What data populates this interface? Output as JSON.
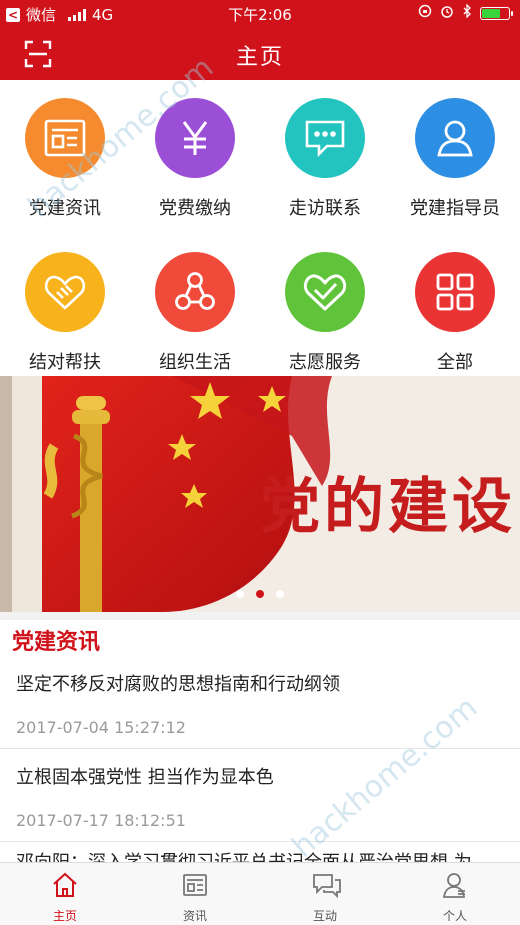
{
  "status": {
    "back_app": "微信",
    "carrier": "4G",
    "time": "下午2:06",
    "battery_level": 0.75
  },
  "header": {
    "title": "主页",
    "scan_icon": "scan-icon"
  },
  "grid": [
    {
      "label": "党建资讯",
      "icon": "news-icon",
      "color": "#f58b2e"
    },
    {
      "label": "党费缴纳",
      "icon": "yen-icon",
      "color": "#9b4fd6"
    },
    {
      "label": "走访联系",
      "icon": "chat-icon",
      "color": "#23c4c0"
    },
    {
      "label": "党建指导员",
      "icon": "person-icon",
      "color": "#2d8fe4"
    },
    {
      "label": "结对帮扶",
      "icon": "handshake-icon",
      "color": "#f7b21c"
    },
    {
      "label": "组织生活",
      "icon": "network-icon",
      "color": "#f04a3a"
    },
    {
      "label": "志愿服务",
      "icon": "heart-check-icon",
      "color": "#5fc43a"
    },
    {
      "label": "全部",
      "icon": "grid-icon",
      "color": "#ea3434"
    }
  ],
  "banner": {
    "text": "党的建设",
    "page_count": 3,
    "active_index": 1
  },
  "section": {
    "title": "党建资讯"
  },
  "news": [
    {
      "title": "坚定不移反对腐败的思想指南和行动纲领",
      "date": "2017-07-04 15:27:12"
    },
    {
      "title": "立根固本强党性 担当作为显本色",
      "date": "2017-07-17 18:12:51"
    },
    {
      "title": "邓向阳：深入学习贯彻习近平总书记全面从严治党思想 为",
      "date": ""
    }
  ],
  "tabbar": [
    {
      "label": "主页",
      "icon": "home-icon",
      "active": true
    },
    {
      "label": "资讯",
      "icon": "news-tab-icon",
      "active": false
    },
    {
      "label": "互动",
      "icon": "chat-tab-icon",
      "active": false
    },
    {
      "label": "个人",
      "icon": "user-tab-icon",
      "active": false
    }
  ],
  "colors": {
    "brand_red": "#d0121b",
    "tab_active": "#d0121b"
  }
}
